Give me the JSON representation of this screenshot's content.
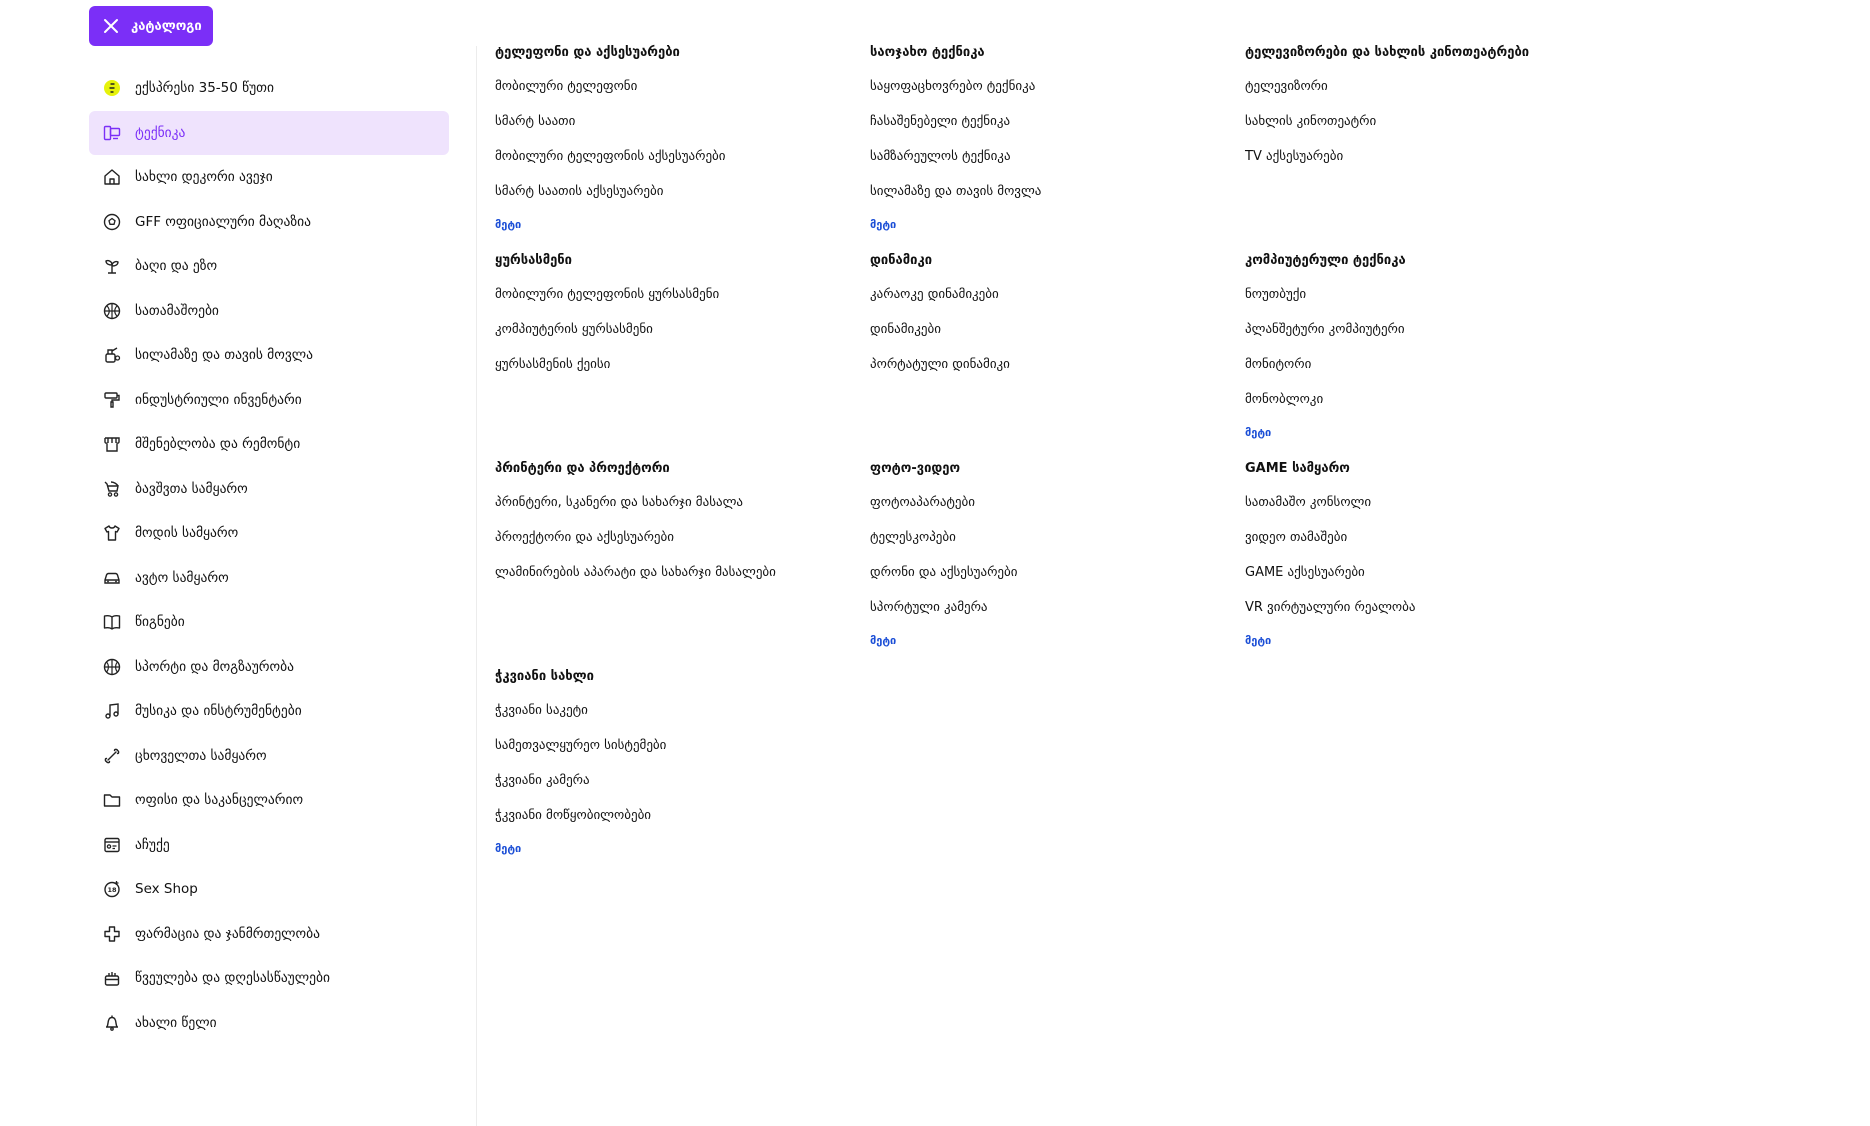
{
  "header": {
    "catalog_label": "კატალოგი"
  },
  "sidebar": {
    "items": [
      {
        "label": "ექსპრესი 35-50 წუთი",
        "icon": "express-bolt-icon"
      },
      {
        "label": "ტექნიკა",
        "icon": "tech-devices-icon"
      },
      {
        "label": "სახლი დეკორი ავეჯი",
        "icon": "home-icon"
      },
      {
        "label": "GFF ოფიციალური მაღაზია",
        "icon": "soccer-ball-icon"
      },
      {
        "label": "ბაღი და ეზო",
        "icon": "plant-icon"
      },
      {
        "label": "სათამაშოები",
        "icon": "toy-ball-icon"
      },
      {
        "label": "სილამაზე და თავის მოვლა",
        "icon": "beauty-icon"
      },
      {
        "label": "ინდუსტრიული ინვენტარი",
        "icon": "paint-roller-icon"
      },
      {
        "label": "მშენებლობა და რემონტი",
        "icon": "store-icon"
      },
      {
        "label": "ბავშვთა სამყარო",
        "icon": "stroller-icon"
      },
      {
        "label": "მოდის სამყარო",
        "icon": "tshirt-icon"
      },
      {
        "label": "ავტო სამყარო",
        "icon": "car-icon"
      },
      {
        "label": "წიგნები",
        "icon": "book-icon"
      },
      {
        "label": "სპორტი და მოგზაურობა",
        "icon": "basketball-icon"
      },
      {
        "label": "მუსიკა და ინსტრუმენტები",
        "icon": "music-note-icon"
      },
      {
        "label": "ცხოველთა სამყარო",
        "icon": "bone-icon"
      },
      {
        "label": "ოფისი და საკანცელარიო",
        "icon": "folder-icon"
      },
      {
        "label": "აჩუქე",
        "icon": "gift-card-icon"
      },
      {
        "label": "Sex Shop",
        "icon": "adult-18-icon"
      },
      {
        "label": "ფარმაცია და ჯანმრთელობა",
        "icon": "medical-cross-icon"
      },
      {
        "label": "წვეულება და დღესასწაულები",
        "icon": "party-icon"
      },
      {
        "label": "ახალი წელი",
        "icon": "christmas-bell-icon"
      }
    ],
    "active_index": 1
  },
  "menu": {
    "more_label": "მეტი",
    "groups": [
      {
        "title": "ტელეფონი და აქსესუარები",
        "links": [
          "მობილური ტელეფონი",
          "სმარტ საათი",
          "მობილური ტელეფონის აქსესუარები",
          "სმარტ საათის აქსესუარები"
        ],
        "more": true
      },
      {
        "title": "საოჯახო ტექნიკა",
        "links": [
          "საყოფაცხოვრებო ტექნიკა",
          "ჩასაშენებელი ტექნიკა",
          "სამზარეულოს ტექნიკა",
          "სილამაზე და თავის მოვლა"
        ],
        "more": true
      },
      {
        "title": "ტელევიზორები და სახლის კინოთეატრები",
        "links": [
          "ტელევიზორი",
          "სახლის კინოთეატრი",
          "TV აქსესუარები"
        ],
        "more": false
      },
      {
        "title": "ყურსასმენი",
        "links": [
          "მობილური ტელეფონის ყურსასმენი",
          "კომპიუტერის ყურსასმენი",
          "ყურსასმენის ქეისი"
        ],
        "more": false
      },
      {
        "title": "დინამიკი",
        "links": [
          "კარაოკე დინამიკები",
          "დინამიკები",
          "პორტატული დინამიკი"
        ],
        "more": false
      },
      {
        "title": "კომპიუტერული ტექნიკა",
        "links": [
          "ნოუთბუქი",
          "პლანშეტური კომპიუტერი",
          "მონიტორი",
          "მონობლოკი"
        ],
        "more": true
      },
      {
        "title": "პრინტერი და პროექტორი",
        "links": [
          "პრინტერი, სკანერი და სახარჯი მასალა",
          "პროექტორი და აქსესუარები",
          "ლამინირების აპარატი და სახარჯი მასალები"
        ],
        "more": false
      },
      {
        "title": "ფოტო-ვიდეო",
        "links": [
          "ფოტოაპარატები",
          "ტელესკოპები",
          "დრონი და აქსესუარები",
          "სპორტული კამერა"
        ],
        "more": true
      },
      {
        "title": "GAME სამყარო",
        "links": [
          "სათამაშო კონსოლი",
          "ვიდეო თამაშები",
          "GAME აქსესუარები",
          "VR ვირტუალური რეალობა"
        ],
        "more": true
      },
      {
        "title": "ჭკვიანი სახლი",
        "links": [
          "ჭკვიანი საკეტი",
          "სამეთვალყურეო სისტემები",
          "ჭკვიანი კამერა",
          "ჭკვიანი მოწყობილობები"
        ],
        "more": true
      }
    ]
  },
  "colors": {
    "accent": "#7b2ff7",
    "active_bg": "#efe3fd",
    "link_more": "#1b4ed6",
    "express_badge": "#e6f20b"
  }
}
